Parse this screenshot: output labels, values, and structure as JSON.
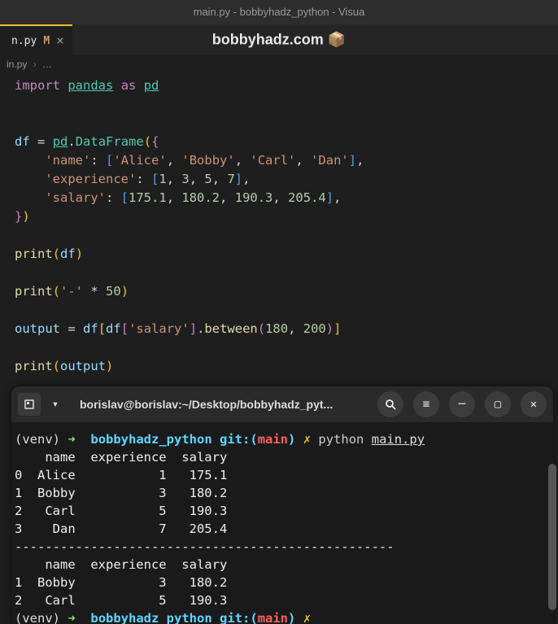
{
  "titlebar": "main.py - bobbyhadz_python - Visua",
  "tab": {
    "filename": "n.py",
    "modified": "M",
    "close": "×"
  },
  "watermark": {
    "text": "bobbyhadz.com",
    "icon": "📦"
  },
  "breadcrumb": {
    "file": "in.py",
    "sep": "›",
    "more": "…"
  },
  "code": {
    "l1_import": "import",
    "l1_pandas": "pandas",
    "l1_as": "as",
    "l1_pd": "pd",
    "l3_df": "df",
    "l3_pd": "pd",
    "l3_DataFrame": "DataFrame",
    "l4_name": "'name'",
    "l4_alice": "'Alice'",
    "l4_bobby": "'Bobby'",
    "l4_carl": "'Carl'",
    "l4_dan": "'Dan'",
    "l5_exp": "'experience'",
    "l5_1": "1",
    "l5_3": "3",
    "l5_5": "5",
    "l5_7": "7",
    "l6_salary": "'salary'",
    "l6_a": "175.1",
    "l6_b": "180.2",
    "l6_c": "190.3",
    "l6_d": "205.4",
    "l8_print": "print",
    "l8_df": "df",
    "l9_print": "print",
    "l9_dash": "'-'",
    "l9_50": "50",
    "l10_output": "output",
    "l10_df": "df",
    "l10_salary": "'salary'",
    "l10_between": "between",
    "l10_180": "180",
    "l10_200": "200",
    "l11_print": "print",
    "l11_output": "output"
  },
  "terminal": {
    "title": "borislav@borislav:~/Desktop/bobbyhadz_pyt...",
    "prompt1": {
      "venv": "(venv)",
      "arrow": "➜",
      "dir": "bobbyhadz_python",
      "git": "git:(",
      "branch": "main",
      "gitc": ")",
      "x": "✗",
      "cmd": "python",
      "file": "main.py"
    },
    "out_header": "    name  experience  salary",
    "out_r0": "0  Alice           1   175.1",
    "out_r1": "1  Bobby           3   180.2",
    "out_r2": "2   Carl           5   190.3",
    "out_r3": "3    Dan           7   205.4",
    "sep": "--------------------------------------------------",
    "out2_header": "    name  experience  salary",
    "out2_r1": "1  Bobby           3   180.2",
    "out2_r2": "2   Carl           5   190.3",
    "prompt2": {
      "venv": "(venv)",
      "arrow": "➜",
      "dir": "bobbyhadz_python",
      "git": "git:(",
      "branch": "main",
      "gitc": ")",
      "x": "✗"
    }
  },
  "chart_data": {
    "type": "table",
    "title": "DataFrame output",
    "columns": [
      "name",
      "experience",
      "salary"
    ],
    "rows": [
      {
        "index": 0,
        "name": "Alice",
        "experience": 1,
        "salary": 175.1
      },
      {
        "index": 1,
        "name": "Bobby",
        "experience": 3,
        "salary": 180.2
      },
      {
        "index": 2,
        "name": "Carl",
        "experience": 5,
        "salary": 190.3
      },
      {
        "index": 3,
        "name": "Dan",
        "experience": 7,
        "salary": 205.4
      }
    ],
    "filtered_rows": [
      {
        "index": 1,
        "name": "Bobby",
        "experience": 3,
        "salary": 180.2
      },
      {
        "index": 2,
        "name": "Carl",
        "experience": 5,
        "salary": 190.3
      }
    ],
    "filter": "salary between 180 and 200"
  }
}
